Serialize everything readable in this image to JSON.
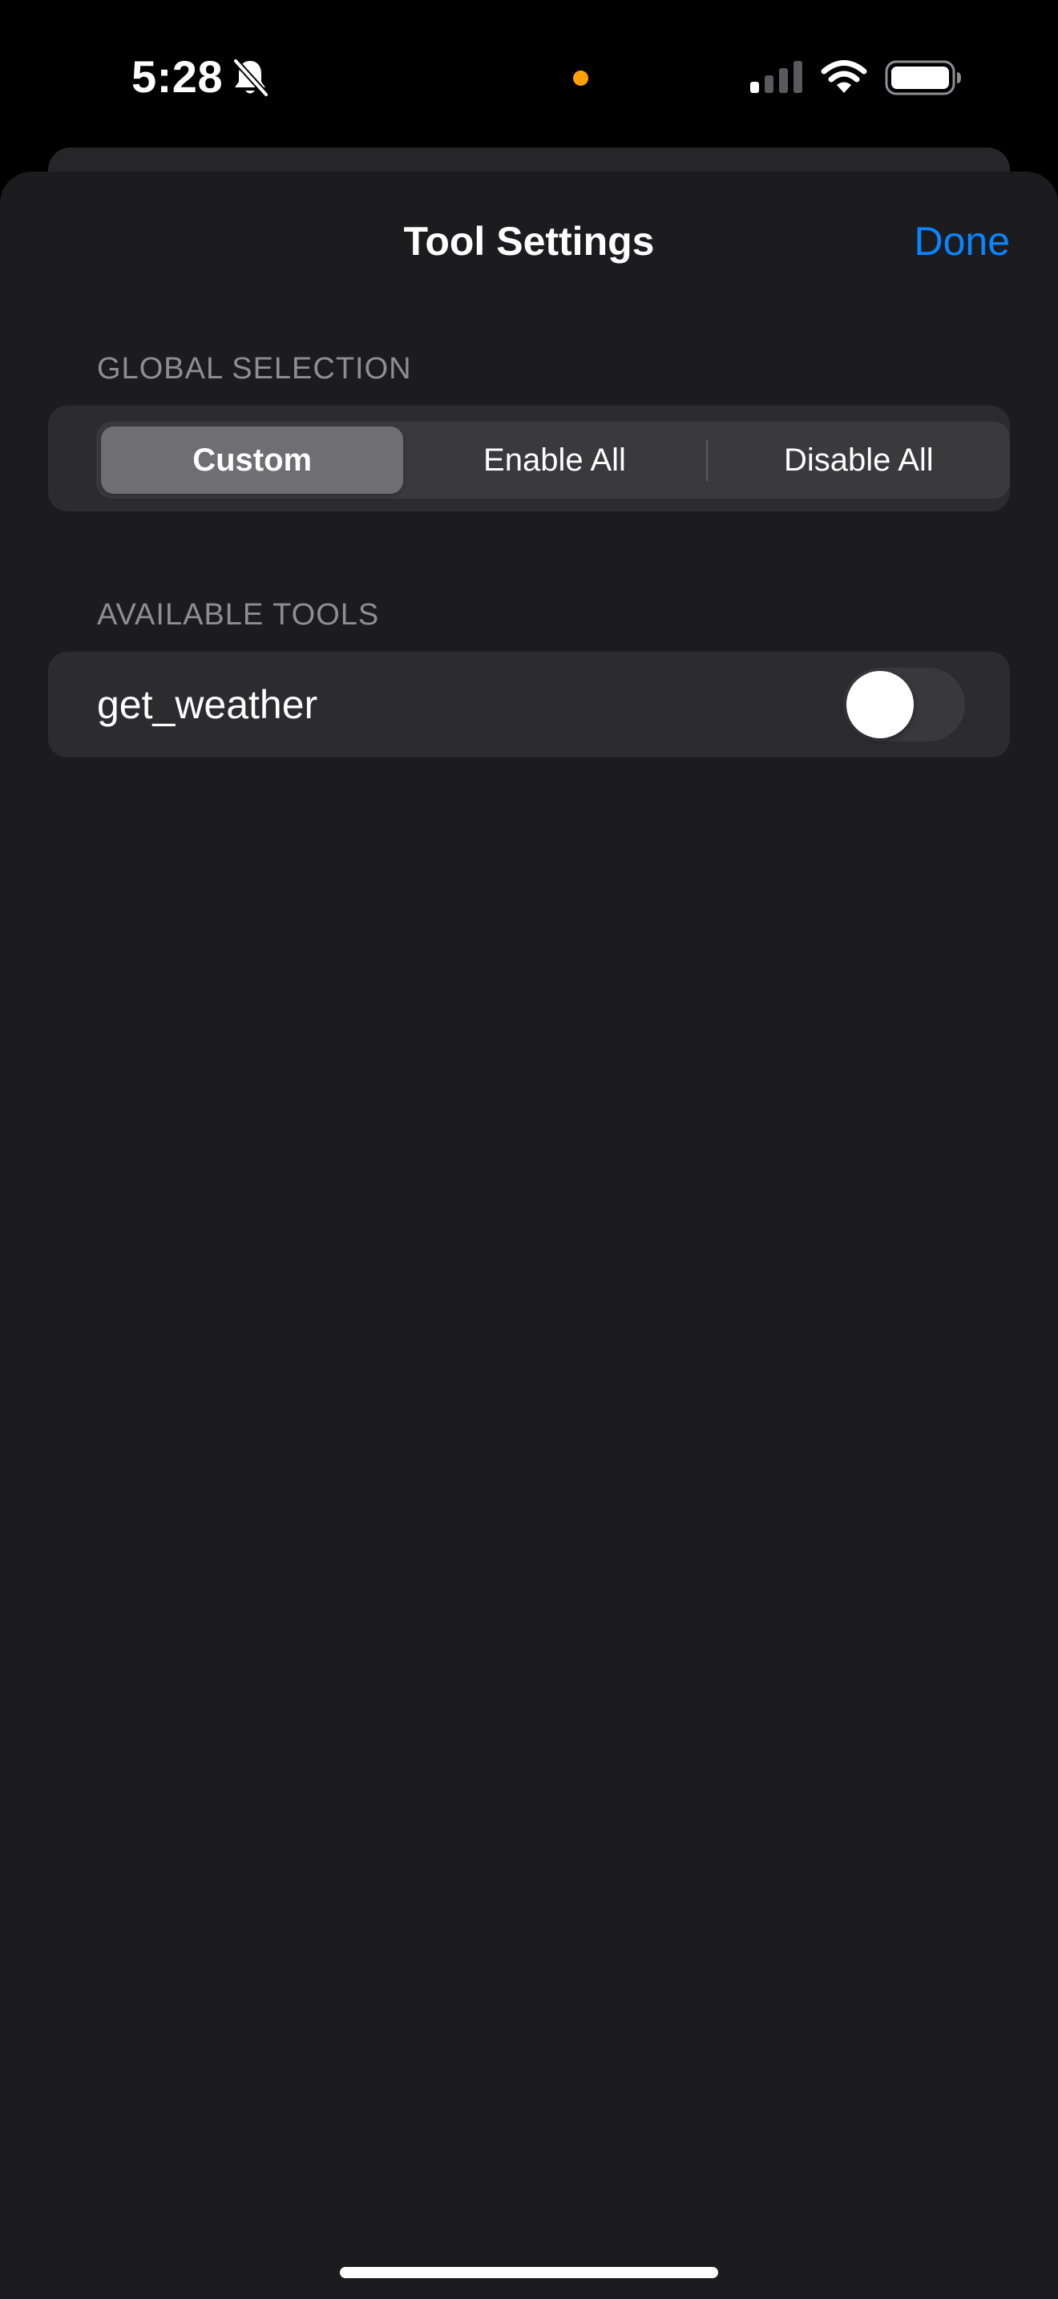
{
  "status_bar": {
    "time": "5:28",
    "icons": [
      "bell-slash-icon",
      "privacy-indicator-dot",
      "cellular-signal-icon",
      "wifi-icon",
      "battery-icon"
    ],
    "privacy_dot_color": "#ff9f0a"
  },
  "nav": {
    "title": "Tool Settings",
    "done_label": "Done",
    "accent_color": "#0a84ff"
  },
  "global_selection": {
    "header": "GLOBAL SELECTION",
    "segments": [
      "Custom",
      "Enable All",
      "Disable All"
    ],
    "selected": "Custom"
  },
  "available_tools": {
    "header": "AVAILABLE TOOLS",
    "items": [
      {
        "label": "get_weather",
        "enabled": false
      }
    ]
  },
  "colors": {
    "sheet_background": "#1c1c1e",
    "card_background": "#2c2c2e",
    "secondary_text": "#8e8e93"
  }
}
